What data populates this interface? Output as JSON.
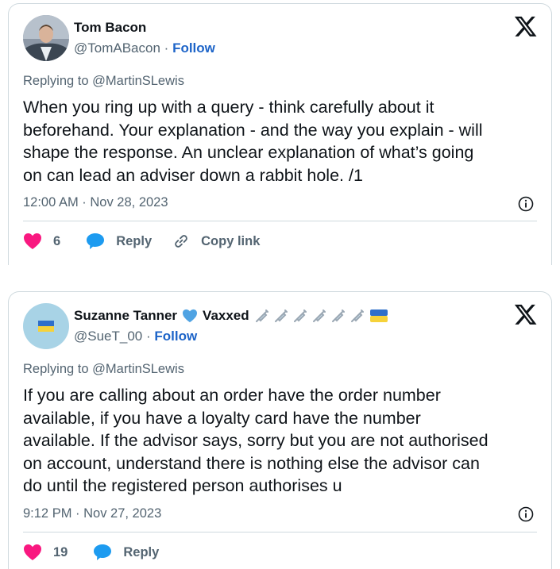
{
  "tweets": [
    {
      "name": "Tom Bacon",
      "handle": "@TomABacon",
      "separator": "·",
      "follow": "Follow",
      "replying_prefix": "Replying to",
      "replying_to": "@MartinSLewis",
      "body_lines": [
        "When you ring up with a query - think carefully about it",
        "beforehand. Your explanation - and the way you explain - will",
        "shape the response. An unclear explanation of what’s going",
        "on can lead an adviser down a rabbit hole. /1"
      ],
      "timestamp": "12:00 AM · Nov 28, 2023",
      "likes": "6",
      "reply_label": "Reply",
      "copy_label": "Copy link"
    },
    {
      "name": "Suzanne Tanner",
      "name_suffix": "Vaxxed",
      "handle": "@SueT_00",
      "separator": "·",
      "follow": "Follow",
      "replying_prefix": "Replying to",
      "replying_to": "@MartinSLewis",
      "body_lines": [
        "If you are calling about an order have the order number",
        "available, if you have a loyalty card have the number",
        "available. If the advisor says, sorry but you are not authorised",
        "on account, understand there is nothing else the advisor can",
        "do until the registered person authorises u"
      ],
      "timestamp": "9:12 PM · Nov 27, 2023",
      "likes": "19",
      "reply_label": "Reply"
    }
  ],
  "icons": {
    "close": "x-logo-icon",
    "like": "heart-icon",
    "reply": "speech-bubble-icon",
    "copy": "link-icon",
    "info": "info-icon",
    "heart_badge": "blue-heart-icon",
    "syringe": "syringe-icon",
    "flag": "ukraine-flag-icon"
  },
  "colors": {
    "like": "#f91880",
    "reply": "#1d9bf0",
    "follow": "#1d64c8",
    "muted": "#536471",
    "text": "#0f1419",
    "border": "#cfd9de"
  }
}
